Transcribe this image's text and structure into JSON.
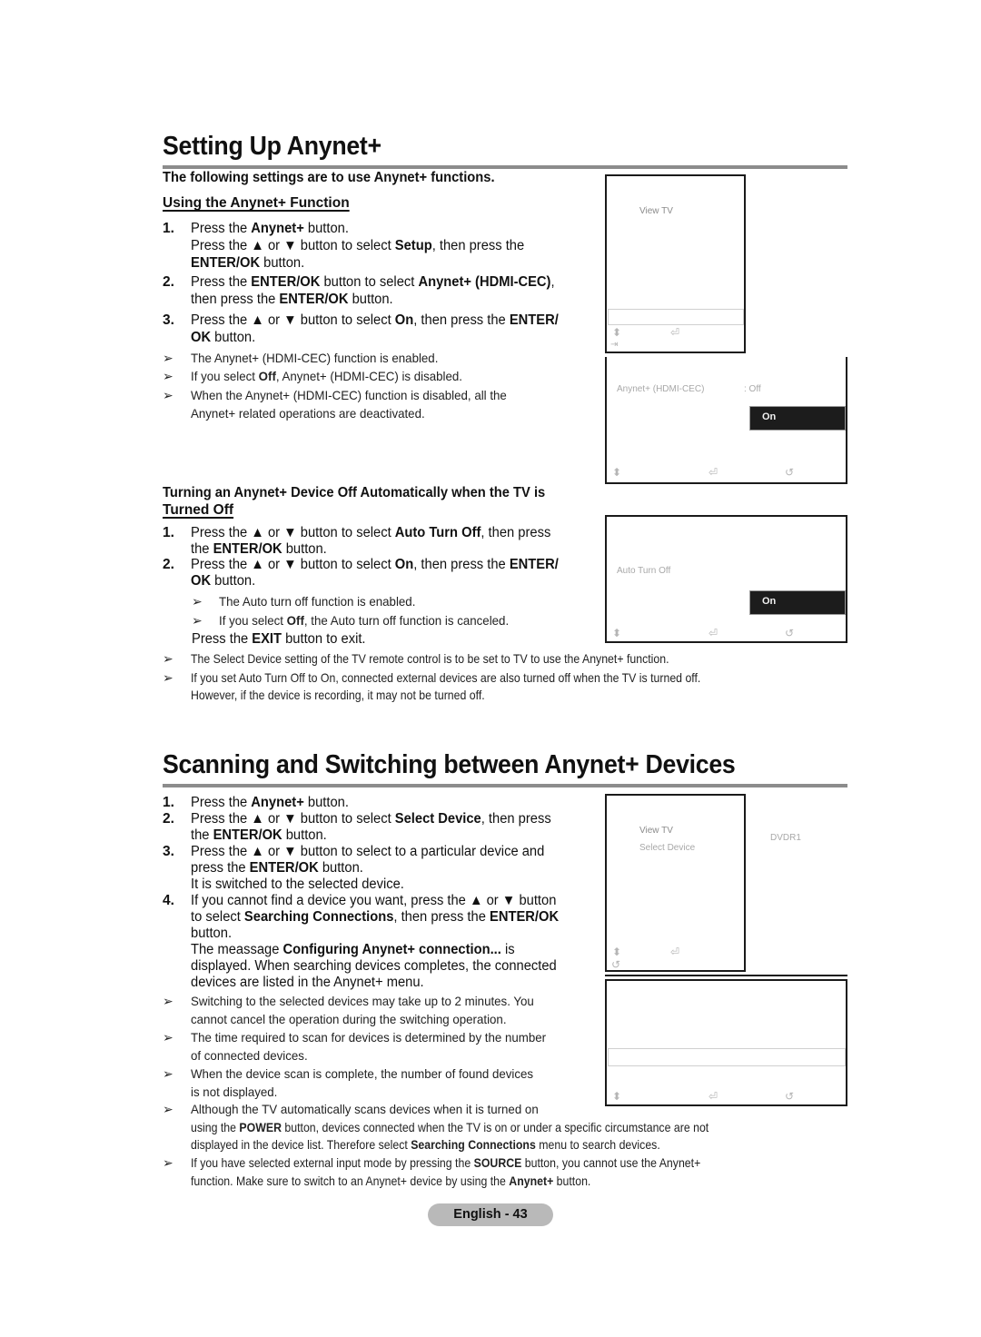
{
  "section1": {
    "title": "Setting Up Anynet+",
    "intro": "The following settings are to use Anynet+ functions.",
    "subheading": "Using the Anynet+ Function",
    "steps": [
      {
        "num": "1.",
        "lines": [
          "Press the <b>Anynet+</b> button.",
          "Press the ▲ or ▼ button to select <b>Setup</b>, then press the",
          "<b>ENTER/OK</b> button."
        ]
      },
      {
        "num": "2.",
        "lines": [
          "Press the <b>ENTER/OK</b> button to select <b>Anynet+ (HDMI-CEC)</b>,",
          "then press the <b>ENTER/OK</b> button."
        ]
      },
      {
        "num": "3.",
        "lines": [
          "Press the ▲ or ▼ button to select <b>On</b>, then press the <b>ENTER/</b>",
          "<b>OK</b> button."
        ]
      }
    ],
    "notes": [
      "The Anynet+ (HDMI-CEC) function is enabled.",
      "If you select <b>Off</b>, Anynet+ (HDMI-CEC) is disabled.",
      "When the Anynet+ (HDMI-CEC) function is disabled, all the",
      "Anynet+ related operations are deactivated."
    ],
    "subheading2_line1": "Turning an Anynet+ Device Off Automatically when the TV is",
    "subheading2_line2": "Turned Off",
    "steps2": [
      {
        "num": "1.",
        "lines": [
          "Press the ▲ or ▼ button to select <b>Auto Turn Off</b>, then press",
          "the <b>ENTER/OK</b> button."
        ]
      },
      {
        "num": "2.",
        "lines": [
          "Press the ▲ or ▼ button to select <b>On</b>, then press the <b>ENTER/</b>",
          "<b>OK</b> button."
        ]
      }
    ],
    "notes2": [
      "The Auto turn off function is enabled.",
      "If you select <b>Off</b>, the Auto turn off function is canceled."
    ],
    "exit_line": "Press the <b>EXIT</b> button to exit.",
    "notes3": [
      "The Select Device setting of the TV remote control is to be set to TV to use the Anynet+ function.",
      "If you set Auto Turn Off to On, connected external devices are also turned off when the TV is turned off.",
      "However, if the device is recording, it may not be turned off."
    ]
  },
  "screens": {
    "menu1": {
      "item": "View TV"
    },
    "hdmi_cec": {
      "label": "Anynet+ (HDMI-CEC)",
      "value": ": Off",
      "selected_option": "On"
    },
    "auto_turn_off": {
      "label": "Auto Turn Off",
      "selected_option": "On"
    },
    "menu2": {
      "item1": "View TV",
      "item2": "Select Device",
      "device": "DVDR1"
    }
  },
  "section2": {
    "title": "Scanning and Switching between Anynet+ Devices",
    "steps": [
      {
        "num": "1.",
        "lines": [
          "Press the <b>Anynet+</b> button."
        ]
      },
      {
        "num": "2.",
        "lines": [
          "Press the ▲ or ▼ button to select <b>Select Device</b>, then press",
          "the <b>ENTER/OK</b> button."
        ]
      },
      {
        "num": "3.",
        "lines": [
          "Press the ▲ or ▼ button to select to a particular device and",
          "press the <b>ENTER/OK</b> button.",
          "It is switched to the selected device."
        ]
      },
      {
        "num": "4.",
        "lines": [
          "If you cannot find a device you want, press the ▲ or ▼ button",
          "to select <b>Searching Connections</b>, then press the <b>ENTER/OK</b>",
          "button.",
          "The meassage <b>Configuring Anynet+ connection...</b> is",
          "displayed. When searching devices completes, the connected",
          "devices are listed in the Anynet+ menu."
        ]
      }
    ],
    "notes": [
      [
        "Switching to the selected devices may take up to 2 minutes. You",
        "cannot cancel the operation during the switching operation."
      ],
      [
        "The time required to scan for devices is determined by the number",
        "of connected devices."
      ],
      [
        "When the device scan is complete, the number of found devices",
        "is not displayed."
      ],
      [
        "Although the TV automatically scans devices when it is turned on",
        "using the <b>POWER</b> button, devices connected when the TV is on or under a specific circumstance are not",
        "displayed in the device list. Therefore select <b>Searching Connections</b> menu to search devices."
      ],
      [
        "If you have selected external input mode by pressing the <b>SOURCE</b> button, you cannot use the Anynet+",
        "function. Make sure to switch to an Anynet+ device by using the <b>Anynet+</b> button."
      ]
    ]
  },
  "footer": {
    "page_label": "English - 43"
  },
  "icons": {
    "arrow": "➢",
    "updown": "⬍",
    "enter": "⏎",
    "return": "↺",
    "exit": "⇥"
  }
}
